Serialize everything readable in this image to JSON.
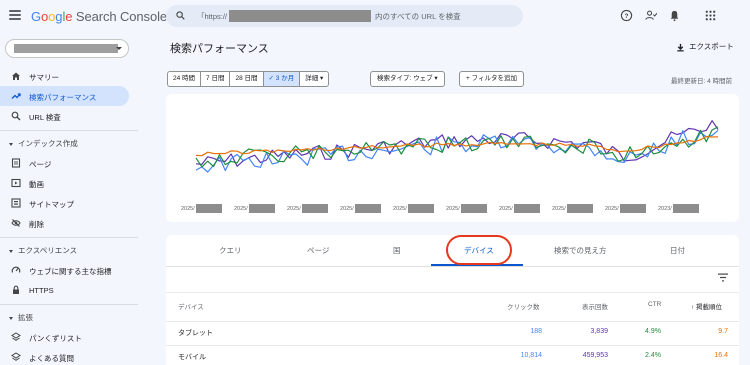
{
  "app": {
    "name_parts": [
      "G",
      "o",
      "o",
      "g",
      "l",
      "e"
    ],
    "product": "Search Console"
  },
  "search": {
    "prefix": "「https://",
    "suffix": "内のすべての URL を検査"
  },
  "sidebar": {
    "items": [
      {
        "label": "サマリー",
        "icon": "home-icon"
      },
      {
        "label": "検索パフォーマンス",
        "icon": "trending-up-icon",
        "active": true
      },
      {
        "label": "URL 検査",
        "icon": "search-icon"
      }
    ],
    "sections": [
      {
        "title": "インデックス作成",
        "items": [
          {
            "label": "ページ",
            "icon": "page-icon"
          },
          {
            "label": "動画",
            "icon": "video-icon"
          },
          {
            "label": "サイトマップ",
            "icon": "sitemap-icon"
          },
          {
            "label": "削除",
            "icon": "eye-off-icon"
          }
        ]
      },
      {
        "title": "エクスペリエンス",
        "items": [
          {
            "label": "ウェブに関する主な指標",
            "icon": "gauge-icon"
          },
          {
            "label": "HTTPS",
            "icon": "lock-icon"
          }
        ]
      },
      {
        "title": "拡張",
        "items": [
          {
            "label": "パンくずリスト",
            "icon": "layers-icon"
          },
          {
            "label": "よくある質問",
            "icon": "layers-icon"
          }
        ]
      }
    ]
  },
  "header": {
    "title": "検索パフォーマンス",
    "export_label": "エクスポート"
  },
  "filters": {
    "ranges": [
      "24 時間",
      "7 日間",
      "28 日間",
      "✓ 3 か月",
      "詳細 ▾"
    ],
    "search_type": "検索タイプ: ウェブ ▾",
    "add_filter": "+ フィルタを追加",
    "last_updated": "最終更新日: 4 時間前"
  },
  "chart": {
    "x_labels": [
      "2025/",
      "2025/",
      "2025/",
      "2025/",
      "2025/",
      "2025/",
      "2025/",
      "2025/",
      "2025/",
      "2025/",
      "2025/",
      "2025/",
      "2025/",
      "2025/",
      "2025/",
      "2025/",
      "2025/",
      "2025/",
      "2025/",
      "2025/",
      "2025/",
      "2025/",
      "2025/",
      "2025/",
      "2025/",
      "2025/",
      "2025/",
      "2025/",
      "2025/",
      "2025/",
      "2025/",
      "2025/",
      "2025/",
      "2025/",
      "2025/",
      "2025/",
      "2025/",
      "2025/",
      "2025/",
      "2025/",
      "2025/",
      "2025/",
      "2025/",
      "2025/",
      "2025/",
      "2025/",
      "2025/",
      "2025/",
      "2025/",
      "2025/"
    ],
    "x_labels_shown": [
      "2025/",
      "2025/",
      "2025/",
      "2025/",
      "2025/",
      "2025/",
      "2025/",
      "2025/",
      "2025/",
      "2025/"
    ],
    "x_label_last": "2025/",
    "x_label_end": "2023/"
  },
  "tabs": [
    "クエリ",
    "ページ",
    "国",
    "デバイス",
    "検索での見え方",
    "日付"
  ],
  "table": {
    "headers": [
      "デバイス",
      "クリック数",
      "表示回数",
      "CTR",
      "↑ 掲載順位"
    ],
    "rows": [
      {
        "device": "タブレット",
        "clicks": "188",
        "impressions": "3,839",
        "ctr": "4.9%",
        "position": "9.7"
      },
      {
        "device": "モバイル",
        "clicks": "10,814",
        "impressions": "459,953",
        "ctr": "2.4%",
        "position": "16.4"
      }
    ]
  },
  "colors": {
    "clicks": "#4285f4",
    "impressions": "#5e35b1",
    "ctr": "#1e8e3e",
    "position": "#e8710a",
    "accent": "#0b57d0",
    "highlight": "#e5391f"
  }
}
